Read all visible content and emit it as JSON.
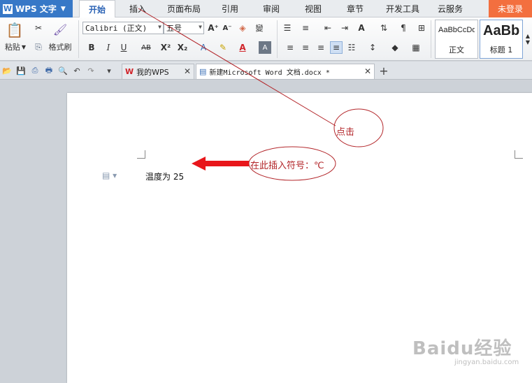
{
  "app": {
    "name": "WPS 文字"
  },
  "menu": {
    "tabs": [
      "开始",
      "插入",
      "页面布局",
      "引用",
      "审阅",
      "视图",
      "章节",
      "开发工具",
      "云服务"
    ],
    "login": "未登录"
  },
  "ribbon": {
    "paste": "粘贴",
    "format_painter": "格式刷",
    "font_name": "Calibri (正文)",
    "font_size": "五号",
    "styles": [
      {
        "sample": "AaBbCcDd",
        "caption": "正文"
      },
      {
        "sample": "AaBb",
        "caption": "标题 1"
      }
    ]
  },
  "tabs": [
    {
      "label": "我的WPS",
      "active": false
    },
    {
      "label": "新建Microsoft Word 文档.docx *",
      "active": true
    }
  ],
  "document": {
    "text": "温度为 25"
  },
  "annotations": {
    "click_note": "点击",
    "insert_note": "在此插入符号：℃"
  },
  "watermark": {
    "logo": "Baidu经验",
    "url": "jingyan.baidu.com"
  },
  "colors": {
    "accent": "#3778c7",
    "login": "#f36f3f",
    "annotation": "#b3262a",
    "arrow": "#e8161b"
  }
}
